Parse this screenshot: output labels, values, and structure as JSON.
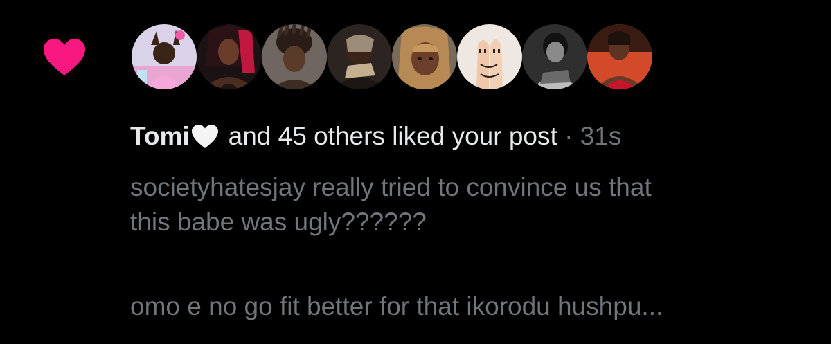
{
  "notification": {
    "user_name": "Tomi",
    "action_text": "and 45 others liked your post",
    "separator": "·",
    "time": "31s",
    "preview_lines": [
      "societyhatesjay really tried to convince us that",
      "this babe was ugly??????",
      "omo e no go fit better for that ikorodu hushpu..."
    ]
  },
  "icons": {
    "like": "heart-icon",
    "name_emoji": "white-heart-icon"
  },
  "colors": {
    "background": "#000000",
    "like_heart": "#f91880",
    "primary_text": "#e7e9ea",
    "secondary_text": "#71767b"
  },
  "avatars": [
    {
      "name": "avatar-1"
    },
    {
      "name": "avatar-2"
    },
    {
      "name": "avatar-3"
    },
    {
      "name": "avatar-4"
    },
    {
      "name": "avatar-5"
    },
    {
      "name": "avatar-6"
    },
    {
      "name": "avatar-7"
    },
    {
      "name": "avatar-8"
    }
  ]
}
